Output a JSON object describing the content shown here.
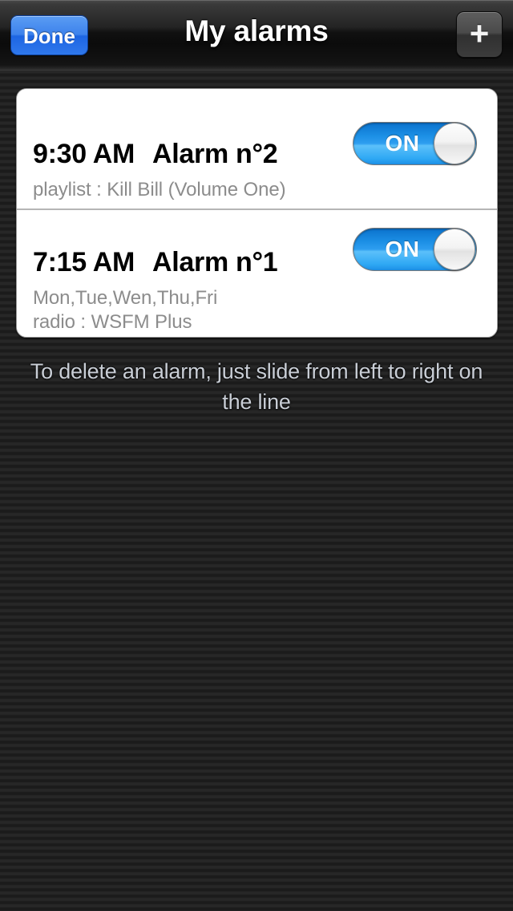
{
  "navbar": {
    "title": "My alarms",
    "done_label": "Done",
    "add_label": "+"
  },
  "alarms": [
    {
      "time": "9:30 AM",
      "name": "Alarm n°2",
      "sub1": "playlist  :  Kill Bill (Volume One)",
      "sub2": "",
      "toggle_label": "ON"
    },
    {
      "time": "7:15 AM",
      "name": "Alarm n°1",
      "sub1": "Mon,Tue,Wen,Thu,Fri",
      "sub2": "radio  :  WSFM Plus",
      "toggle_label": "ON"
    }
  ],
  "hint": {
    "text": "To delete an alarm, just slide from left to right on the line"
  },
  "colors": {
    "accent_blue": "#2f78ec",
    "toggle_blue": "#2e9ef0",
    "card_white": "#ffffff",
    "subtitle_gray": "#8c8c8c",
    "background_dark": "#222222",
    "hint_gray": "#c9ced6"
  }
}
